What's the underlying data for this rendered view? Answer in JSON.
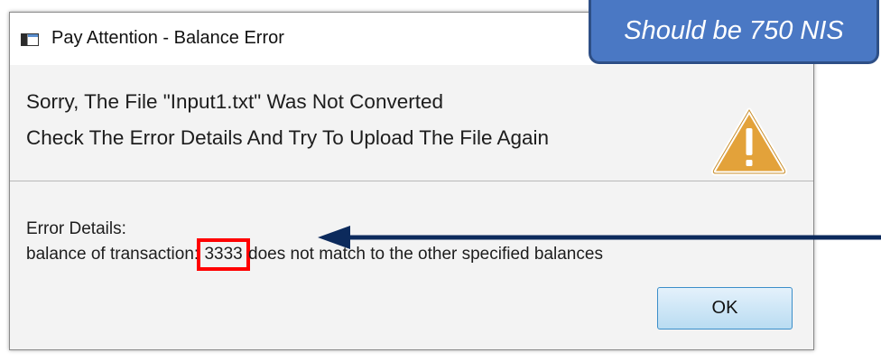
{
  "dialog": {
    "title": "Pay Attention - Balance Error",
    "header_line1": "Sorry, The File \"Input1.txt\" Was Not Converted",
    "header_line2": "Check The Error Details And Try To Upload The File Again",
    "details_label": "Error Details:",
    "details_before": "balance of transaction: ",
    "details_value": "3333",
    "details_after": " does not match to the other specified balances",
    "ok_label": "OK",
    "icon": "warning-icon"
  },
  "annotation": {
    "callout_text": "Should be 750 NIS",
    "arrow": "arrow-left-icon",
    "highlight_color": "#ff0000",
    "callout_color": "#4a78c4"
  }
}
